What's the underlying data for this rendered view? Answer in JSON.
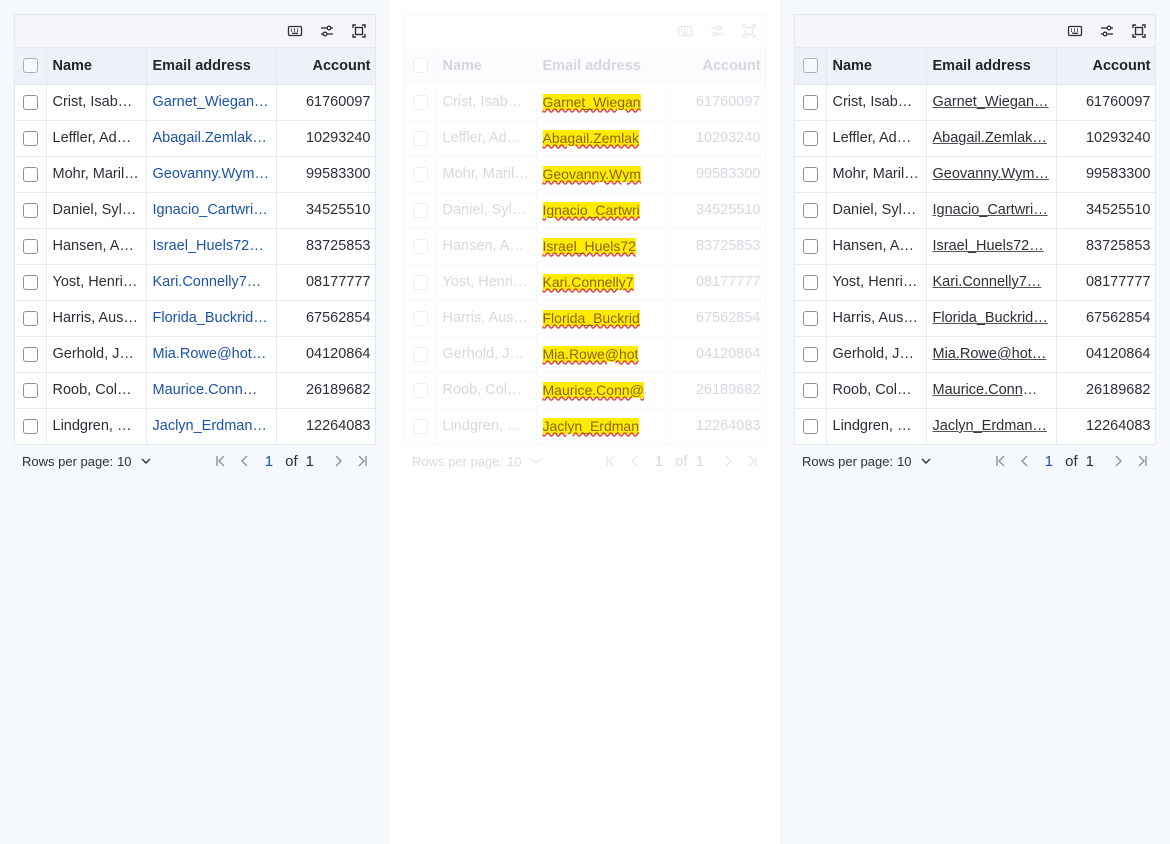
{
  "columns": {
    "name": "Name",
    "email": "Email address",
    "account": "Account"
  },
  "rows": [
    {
      "name": "Crist, Isabe…",
      "email": "Garnet_Wiegan…",
      "account": "61760097"
    },
    {
      "name": "Leffler, Ad…",
      "email": "Abagail.Zemlak…",
      "account": "10293240"
    },
    {
      "name": "Mohr, Maril…",
      "email": "Geovanny.Wym…",
      "account": "99583300"
    },
    {
      "name": "Daniel, Syl…",
      "email": "Ignacio_Cartwri…",
      "account": "34525510"
    },
    {
      "name": "Hansen, As…",
      "email": "Israel_Huels72…",
      "account": "83725853"
    },
    {
      "name": "Yost, Henri…",
      "email": "Kari.Connelly7…",
      "account": "08177777"
    },
    {
      "name": "Harris, Aus…",
      "email": "Florida_Buckrid…",
      "account": "67562854"
    },
    {
      "name": "Gerhold, Je…",
      "email": "Mia.Rowe@hot…",
      "account": "04120864"
    },
    {
      "name": "Roob, Colu…",
      "email": "Maurice.Conn@…",
      "account": "26189682"
    },
    {
      "name": "Lindgren, E…",
      "email": "Jaclyn_Erdman…",
      "account": "12264083"
    }
  ],
  "middle_emails": [
    "Garnet_Wiegan",
    "Abagail.Zemlak",
    "Geovanny.Wym",
    "Ignacio_Cartwri",
    "Israel_Huels72",
    "Kari.Connelly7",
    "Florida_Buckrid",
    "Mia.Rowe@hot",
    "Maurice.Conn@",
    "Jaclyn_Erdman"
  ],
  "footer": {
    "rows_per_page_label": "Rows per page:",
    "rows_per_page_value": "10",
    "current_page": "1",
    "of_label": "of",
    "total_pages": "1"
  },
  "icons": {
    "toolbar": [
      "keyboard-icon",
      "filter-settings-icon",
      "fullscreen-icon"
    ],
    "pager": [
      "first-page-icon",
      "prev-page-icon",
      "next-page-icon",
      "last-page-icon"
    ]
  },
  "colors": {
    "link": "#1a53a8",
    "header_bg": "#eef2f8",
    "highlight": "#ffec00",
    "spell_underline": "#e63b2e"
  }
}
